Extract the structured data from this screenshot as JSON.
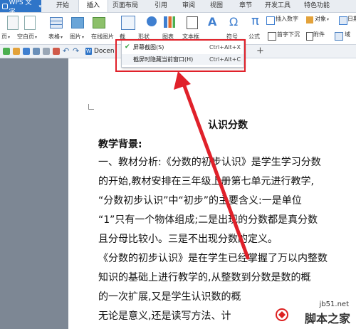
{
  "app": {
    "name": "WPS 文字"
  },
  "tabs": [
    "开始",
    "插入",
    "页面布局",
    "引用",
    "审阅",
    "视图",
    "章节",
    "开发工具",
    "特色功能"
  ],
  "ribbon": {
    "page_label": "页",
    "blank_page": "空白页",
    "table": "表格",
    "picture": "图片",
    "online_chart": "在线图片",
    "screenshot_partial": "截",
    "shape_partial": "形状",
    "chart_partial": "图表",
    "text_partial": "文本框",
    "symbol_partial": "符号",
    "formula": "公式",
    "insert_number": "插入数字",
    "object": "对象",
    "date": "日期",
    "dropcap": "首字下沉",
    "attachment": "附件",
    "doc_field": "域"
  },
  "document_tab": {
    "label": "Docen"
  },
  "menu": {
    "items": [
      {
        "label": "屏幕截图(S)",
        "shortcut": "Ctrl+Alt+X",
        "checked": true
      },
      {
        "label": "截屏时隐藏当前窗口(H)",
        "shortcut": "Ctrl+Alt+C",
        "checked": false
      }
    ]
  },
  "document": {
    "title": "认识分数",
    "heading": "教学背景:",
    "lines": [
      "一、教材分析:《分数的初步认识》是学生学习分数",
      "的开始,教材安排在三年级上册第七单元进行教学,",
      "“分数初步认识”中“初步”的主要含义:一是单位",
      "“1”只有一个物体组成;二是出现的分数都是真分数",
      "且分母比较小。三是不出现分数的定义。",
      "《分数的初步认识》是在学生已经掌握了万以内整数",
      "知识的基础上进行教学的,从整数到分数是数的概",
      "的一次扩展,又是学生认识数的概",
      "无论是意义,还是读写方法、计"
    ]
  },
  "watermark": {
    "url": "jb51.net",
    "name": "脚本之家"
  },
  "colors": {
    "accent": "#2f75c8",
    "highlight": "#e0212a"
  }
}
